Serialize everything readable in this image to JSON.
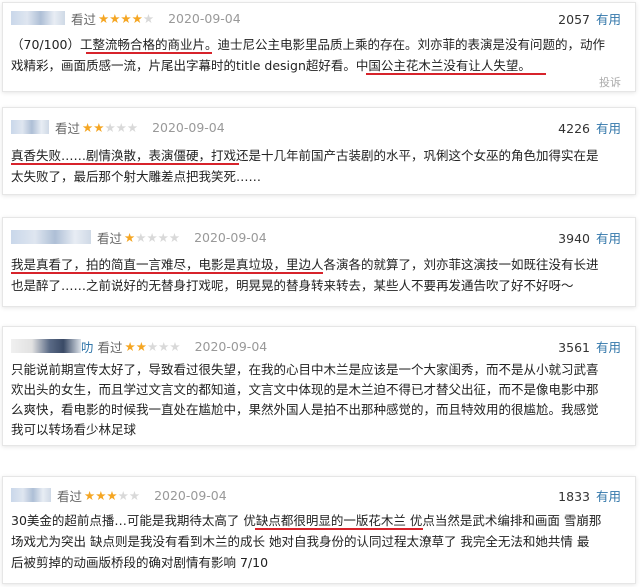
{
  "reviews": [
    {
      "rating_label": "看过",
      "stars": 4,
      "date": "2020-09-04",
      "votes": "2057",
      "useful_label": "有用",
      "lines": [
        "（70/100）工整流畅合格的商业片。迪士尼公主电影里品质上乘的存在。刘亦菲的表演是没有问题的，动作",
        "戏精彩，画面质感一流，片尾出字幕时的title design超好看。中国公主花木兰没有让人失望。"
      ],
      "report_label": "投诉"
    },
    {
      "rating_label": "看过",
      "stars": 2,
      "date": "2020-09-04",
      "votes": "4226",
      "useful_label": "有用",
      "lines": [
        "真香失败……剧情涣散，表演僵硬，打戏还是十几年前国产古装剧的水平，巩俐这个女巫的角色加得实在是",
        "太失败了，最后那个射大雕差点把我笑死……"
      ]
    },
    {
      "rating_label": "看过",
      "stars": 1,
      "date": "2020-09-04",
      "votes": "3940",
      "useful_label": "有用",
      "lines": [
        "我是真看了，拍的简直一言难尽，电影是真垃圾，里边人各演各的就算了，刘亦菲这演技一如既往没有长进",
        "也是醉了……之前说好的无替身打戏呢，明晃晃的替身转来转去，某些人不要再发通告吹了好不好呀～"
      ]
    },
    {
      "rating_label": "看过",
      "stars": 2,
      "date": "2020-09-04",
      "votes": "3561",
      "useful_label": "有用",
      "name_suffix": "叻",
      "lines": [
        "只能说前期宣传太好了，导致看过很失望，在我的心目中木兰是应该是一个大家闺秀，而不是从小就习武喜",
        "欢出头的女生，而且学过文言文的都知道，文言文中体现的是木兰迫不得已才替父出征，而不是像电影中那",
        "么爽快，看电影的时候我一直处在尴尬中，果然外国人是拍不出那种感觉的，而且特效用的很尴尬。我感觉",
        "我可以转场看少林足球"
      ]
    },
    {
      "rating_label": "看过",
      "stars": 3,
      "date": "2020-09-04",
      "votes": "1833",
      "useful_label": "有用",
      "lines": [
        "30美金的超前点播…可能是我期待太高了 优缺点都很明显的一版花木兰 优点当然是武术编排和画面 雪崩那",
        "场戏尤为突出 缺点则是我没有看到木兰的成长 她对自我身份的认同过程太潦草了 我完全无法和她共情 最",
        "后被剪掉的动画版桥段的确对剧情有影响 7/10"
      ]
    }
  ]
}
